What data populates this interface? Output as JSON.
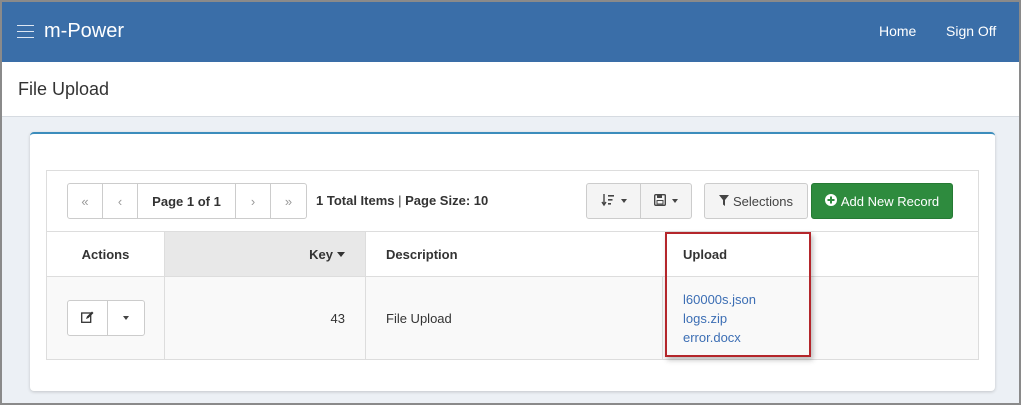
{
  "app": {
    "brand": "m-Power"
  },
  "nav": {
    "home": "Home",
    "sign_off": "Sign Off"
  },
  "page": {
    "title": "File Upload"
  },
  "pager": {
    "first": "«",
    "prev": "‹",
    "label": "Page 1 of 1",
    "next": "›",
    "last": "»"
  },
  "summary": {
    "total": "1 Total Items",
    "separator": " | ",
    "page_size": "Page Size: 10"
  },
  "toolbar": {
    "selections_label": "Selections",
    "add_label": "Add New Record"
  },
  "table": {
    "headers": {
      "actions": "Actions",
      "key": "Key",
      "description": "Description",
      "upload": "Upload"
    },
    "rows": [
      {
        "key": "43",
        "description": "File Upload",
        "files": [
          "l60000s.json",
          "logs.zip",
          "error.docx"
        ]
      }
    ]
  },
  "colors": {
    "topbar": "#3a6ea8",
    "add_button": "#2e8b3e",
    "link": "#3c6eb4",
    "highlight": "#b4262b"
  }
}
